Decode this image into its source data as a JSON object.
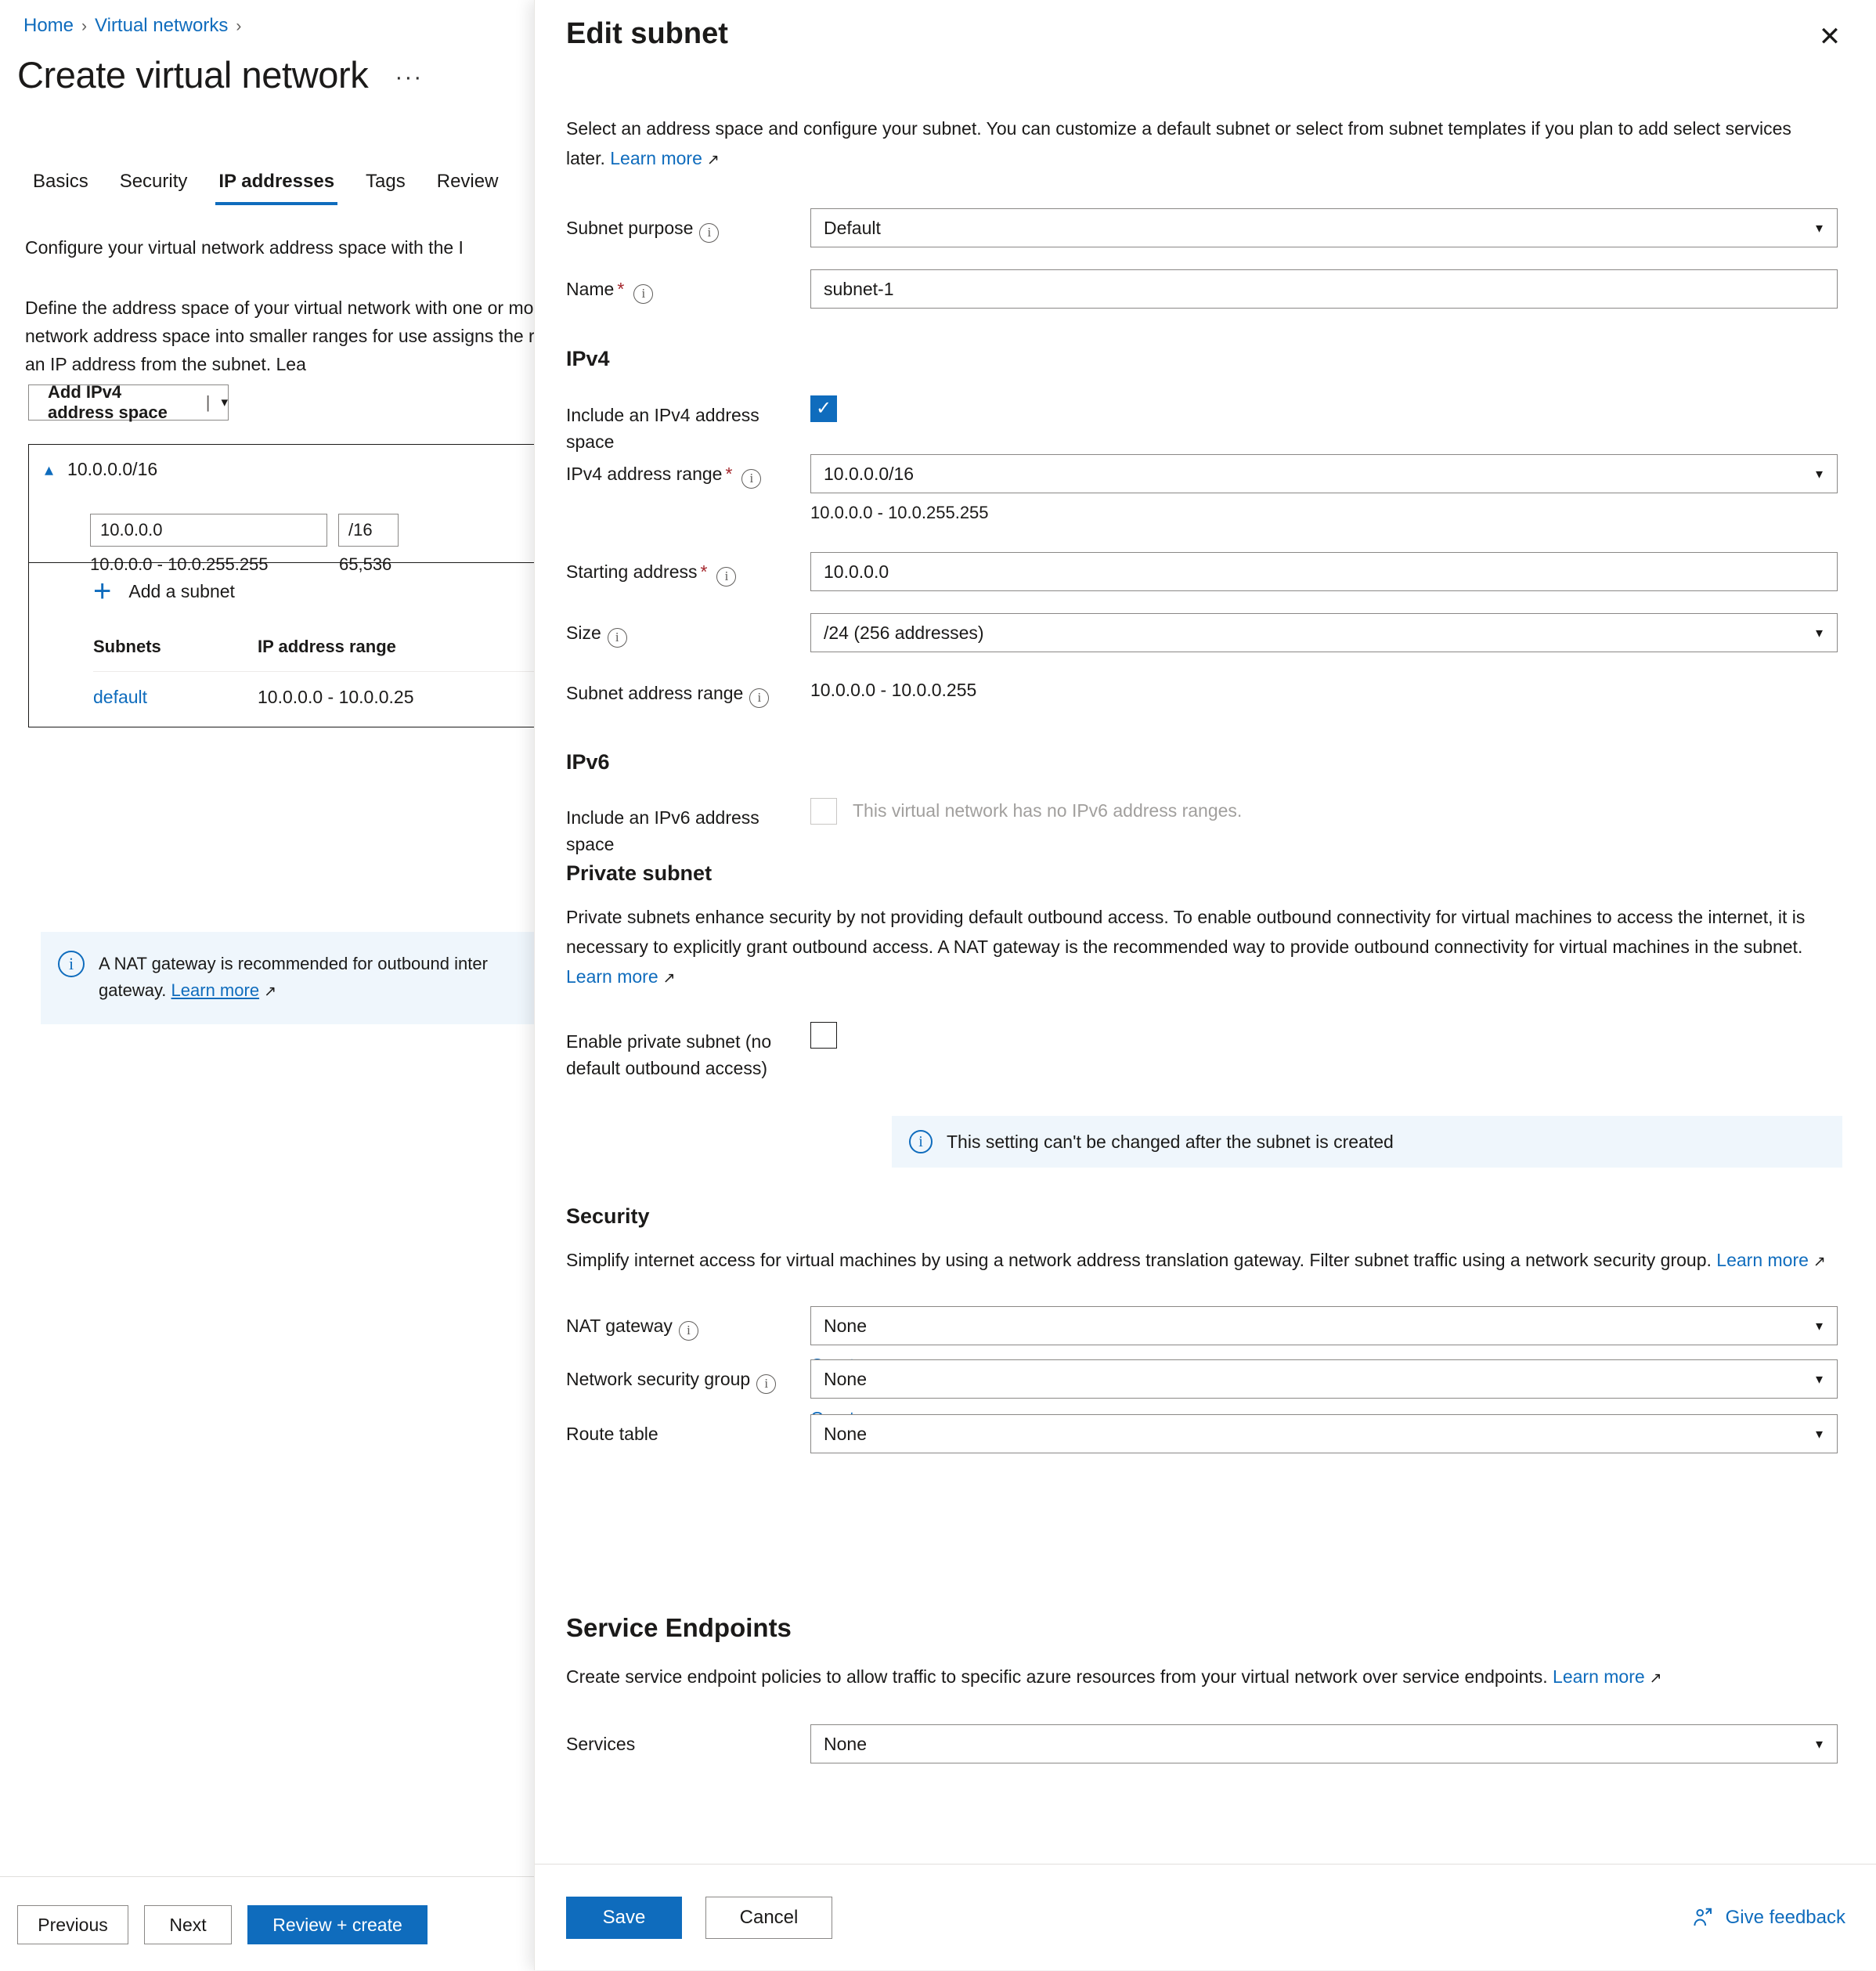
{
  "left": {
    "breadcrumb": {
      "home": "Home",
      "virtual_networks": "Virtual networks",
      "sep": "›"
    },
    "page_title": "Create virtual network",
    "ellipsis": "···",
    "tabs": [
      {
        "label": "Basics",
        "active": false
      },
      {
        "label": "Security",
        "active": false
      },
      {
        "label": "IP addresses",
        "active": true
      },
      {
        "label": "Tags",
        "active": false
      },
      {
        "label": "Review",
        "active": false
      }
    ],
    "paragraph_1": "Configure your virtual network address space with the I",
    "paragraph_2": "Define the address space of your virtual network with one or more virtual network address space into smaller ranges for use assigns the resource an IP address from the subnet. Lea",
    "paragraph_2_link": "Lea",
    "add_ipv4_button": "Add IPv4 address space",
    "add_ipv4_pipe": "|",
    "address_space": {
      "cidr": "10.0.0.0/16",
      "start_value": "10.0.0.0",
      "prefix_value": "/16",
      "range_text": "10.0.0.0 - 10.0.255.255",
      "count_text": "65,536"
    },
    "add_subnet_label": "Add a subnet",
    "subnet_table": {
      "headers": [
        "Subnets",
        "IP address range"
      ],
      "rows": [
        {
          "name": "default",
          "range": "10.0.0.0 - 10.0.0.25"
        }
      ]
    },
    "nat_banner": {
      "text_before": "A NAT gateway is recommended for outbound inter",
      "text_after": "gateway. ",
      "link": "Learn more"
    },
    "footer_buttons": {
      "previous": "Previous",
      "next": "Next",
      "review_create": "Review + create"
    }
  },
  "panel": {
    "title": "Edit subnet",
    "close": "✕",
    "description": "Select an address space and configure your subnet. You can customize a default subnet or select from subnet templates if you plan to add select services later. ",
    "description_link": "Learn more",
    "fields": {
      "subnet_purpose": {
        "label": "Subnet purpose",
        "value": "Default"
      },
      "name": {
        "label": "Name",
        "value": "subnet-1"
      },
      "ipv4_heading": "IPv4",
      "include_ipv4": {
        "label": "Include an IPv4 address space",
        "checked": true
      },
      "ipv4_range": {
        "label": "IPv4 address range",
        "value": "10.0.0.0/16",
        "helper": "10.0.0.0 - 10.0.255.255"
      },
      "starting_address": {
        "label": "Starting address",
        "value": "10.0.0.0"
      },
      "size": {
        "label": "Size",
        "value": "/24 (256 addresses)"
      },
      "subnet_address_range": {
        "label": "Subnet address range",
        "value": "10.0.0.0 - 10.0.0.255"
      },
      "ipv6_heading": "IPv6",
      "include_ipv6": {
        "label": "Include an IPv6 address space",
        "note": "This virtual network has no IPv6 address ranges.",
        "checked": false
      }
    },
    "private_subnet": {
      "heading": "Private subnet",
      "paragraph": "Private subnets enhance security by not providing default outbound access. To enable outbound connectivity for virtual machines to access the internet, it is necessary to explicitly grant outbound access. A NAT gateway is the recommended way to provide outbound connectivity for virtual machines in the subnet. ",
      "paragraph_link": "Learn more",
      "checkbox_label": "Enable private subnet (no default outbound access)",
      "checked": false,
      "info_banner": "This setting can't be changed after the subnet is created"
    },
    "security": {
      "heading": "Security",
      "paragraph": "Simplify internet access for virtual machines by using a network address translation gateway. Filter subnet traffic using a network security group. ",
      "paragraph_link": "Learn more",
      "nat_gateway": {
        "label": "NAT gateway",
        "value": "None",
        "create_new": "Create new"
      },
      "network_security_group": {
        "label": "Network security group",
        "value": "None",
        "create_new": "Create new"
      },
      "route_table": {
        "label": "Route table",
        "value": "None"
      }
    },
    "service_endpoints": {
      "heading": "Service Endpoints",
      "paragraph": "Create service endpoint policies to allow traffic to specific azure resources from your virtual network over service endpoints. ",
      "paragraph_link": "Learn more",
      "services": {
        "label": "Services",
        "value": "None"
      }
    },
    "footer": {
      "save": "Save",
      "cancel": "Cancel",
      "give_feedback": "Give feedback"
    }
  },
  "colors": {
    "accent": "#0f6cbd",
    "link": "#0f6cbd",
    "info_bg": "#eff6fc",
    "required": "#a4262c",
    "border": "#8a8886"
  }
}
